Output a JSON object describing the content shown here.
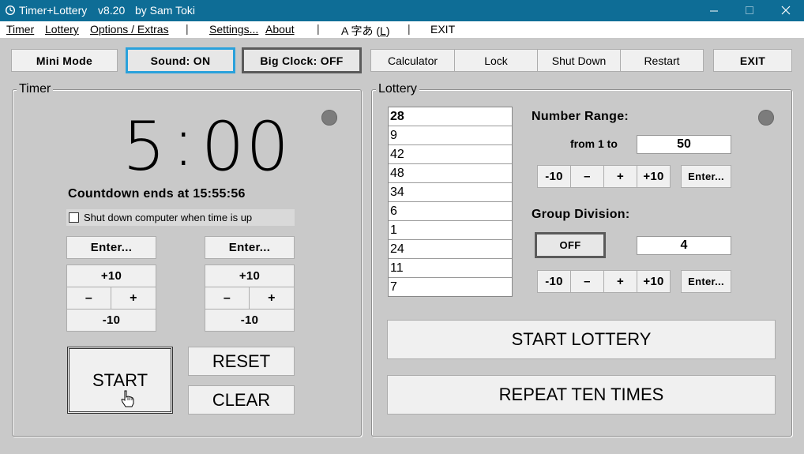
{
  "window": {
    "app_name": "Timer+Lottery",
    "version": "v8.20",
    "author": "by Sam Toki"
  },
  "menu": {
    "timer": "Timer",
    "lottery": "Lottery",
    "options": "Options / Extras",
    "settings": "Settings...",
    "about": "About",
    "lang_prefix": "A 字あ (",
    "lang_key": "L",
    "lang_suffix": ")",
    "exit": "EXIT",
    "separator": "|"
  },
  "toolbar": {
    "mini_mode": "Mini Mode",
    "sound": "Sound: ON",
    "big_clock": "Big Clock: OFF",
    "calculator": "Calculator",
    "lock": "Lock",
    "shut_down": "Shut Down",
    "restart": "Restart",
    "exit": "EXIT"
  },
  "timer": {
    "title": "Timer",
    "minutes": "5",
    "colon": ":",
    "seconds": "00",
    "countdown_text": "Countdown ends at 15:55:56",
    "shutdown_label": "Shut down computer when time is up",
    "shutdown_checked": false,
    "min_enter": "Enter...",
    "sec_enter": "Enter...",
    "plus10": "+10",
    "minus": "–",
    "plus": "+",
    "minus10": "-10",
    "start": "START",
    "reset": "RESET",
    "clear": "CLEAR"
  },
  "lottery": {
    "title": "Lottery",
    "results": [
      "28",
      "9",
      "42",
      "48",
      "34",
      "6",
      "1",
      "24",
      "11",
      "7"
    ],
    "number_range_label": "Number Range:",
    "from_label": "from 1 to",
    "range_value": "50",
    "minus10": "-10",
    "minus": "–",
    "plus": "+",
    "plus10": "+10",
    "enter": "Enter...",
    "group_division_label": "Group Division:",
    "group_toggle": "OFF",
    "group_value": "4",
    "start_lottery": "START LOTTERY",
    "repeat": "REPEAT TEN TIMES"
  },
  "colors": {
    "titlebar": "#0e6d96",
    "background": "#c9c9c9",
    "button": "#f0f0f0",
    "focus_blue": "#2aa1db",
    "indicator": "#7c7c7c"
  }
}
